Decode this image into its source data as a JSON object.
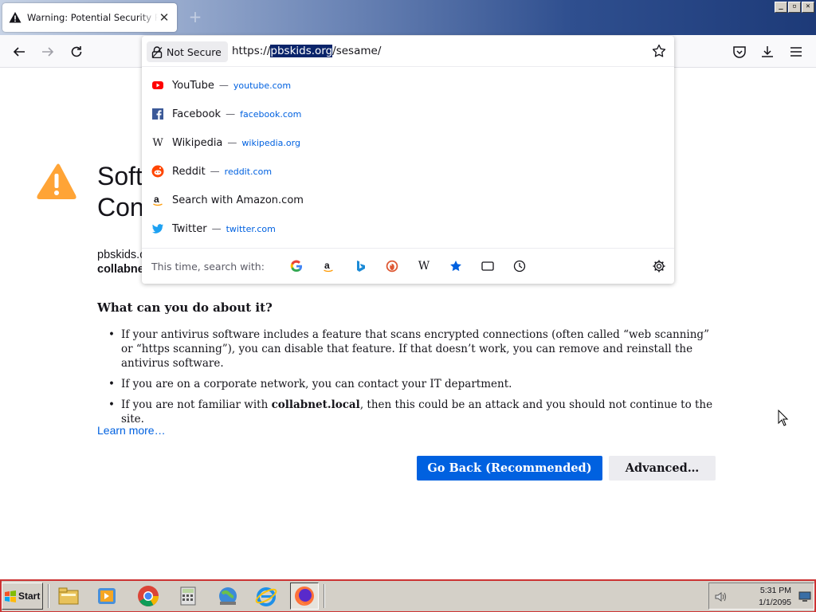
{
  "window": {
    "tab_title": "Warning: Potential Security Risk Ahead",
    "tab_close": "✕",
    "new_tab": "+",
    "controls": {
      "minimize": "_",
      "maximize": "▫",
      "close": "✕"
    }
  },
  "urlbar": {
    "security_label": "Not Secure",
    "url_prefix": "https://",
    "url_highlight": "pbskids.org",
    "url_suffix": "/sesame/"
  },
  "suggestions": [
    {
      "icon": "youtube-icon",
      "title": "YouTube",
      "sep": "—",
      "url": "youtube.com"
    },
    {
      "icon": "facebook-icon",
      "title": "Facebook",
      "sep": "—",
      "url": "facebook.com"
    },
    {
      "icon": "wikipedia-icon",
      "title": "Wikipedia",
      "sep": "—",
      "url": "wikipedia.org"
    },
    {
      "icon": "reddit-icon",
      "title": "Reddit",
      "sep": "—",
      "url": "reddit.com"
    },
    {
      "icon": "amazon-icon",
      "title": "Search with Amazon.com",
      "sep": "",
      "url": ""
    },
    {
      "icon": "twitter-icon",
      "title": "Twitter",
      "sep": "—",
      "url": "twitter.com"
    }
  ],
  "search_engines": {
    "label": "This time, search with:",
    "engines": [
      "google-icon",
      "amazon-icon",
      "bing-icon",
      "duckduckgo-icon",
      "wikipedia-icon",
      "bookmarks-icon",
      "tabs-icon",
      "history-icon"
    ]
  },
  "page": {
    "heading_line1": "Soft",
    "heading_line2": "Con",
    "domain_line1": "pbskids.c",
    "domain_line2": "collabne",
    "what_heading": "What can you do about it?",
    "bullet1": "If your antivirus software includes a feature that scans encrypted connections (often called “web scanning” or “https scanning”), you can disable that feature. If that doesn’t work, you can remove and reinstall the antivirus software.",
    "bullet2": "If you are on a corporate network, you can contact your IT department.",
    "bullet3_pre": "If you are not familiar with ",
    "bullet3_bold": "collabnet.local",
    "bullet3_post": ", then this could be an attack and you should not continue to the site.",
    "learn_more": "Learn more…",
    "go_back": "Go Back (Recommended)",
    "advanced": "Advanced…"
  },
  "taskbar": {
    "start_label": "Start",
    "time": "5:31 PM",
    "date": "1/1/2095"
  },
  "colors": {
    "accent": "#0061e0",
    "warning": "#ffa436"
  }
}
